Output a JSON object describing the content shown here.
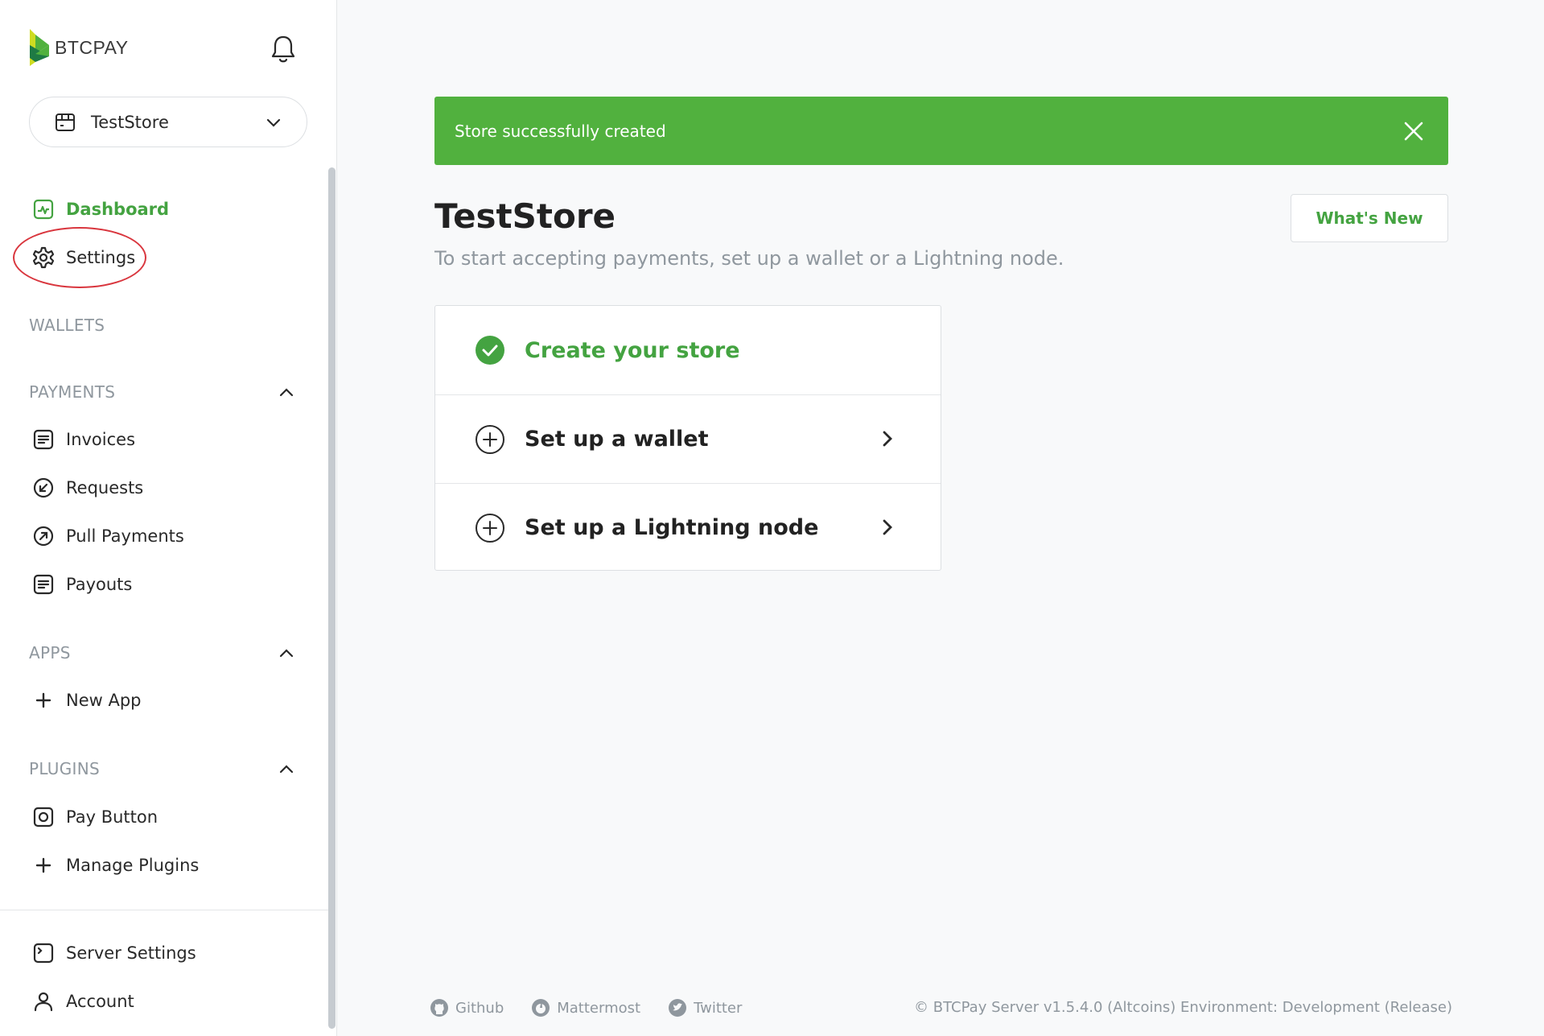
{
  "brand": {
    "name": "BTCPAY",
    "accent": "#44a341"
  },
  "store_selector": {
    "value": "TestStore"
  },
  "nav": {
    "dashboard": "Dashboard",
    "settings": "Settings",
    "wallets_section": "WALLETS",
    "payments_section": "PAYMENTS",
    "invoices": "Invoices",
    "requests": "Requests",
    "pull_payments": "Pull Payments",
    "payouts": "Payouts",
    "apps_section": "APPS",
    "new_app": "New App",
    "plugins_section": "PLUGINS",
    "pay_button": "Pay Button",
    "manage_plugins": "Manage Plugins",
    "server_settings": "Server Settings",
    "account": "Account"
  },
  "alert": {
    "text": "Store successfully created",
    "color": "#51b13e"
  },
  "main": {
    "title": "TestStore",
    "subtitle": "To start accepting payments, set up a wallet or a Lightning node.",
    "whats_new": "What's New"
  },
  "setup_steps": [
    {
      "label": "Create your store",
      "status": "done"
    },
    {
      "label": "Set up a wallet",
      "status": "todo"
    },
    {
      "label": "Set up a Lightning node",
      "status": "todo"
    }
  ],
  "footer": {
    "github": "Github",
    "mattermost": "Mattermost",
    "twitter": "Twitter",
    "copyright": "© BTCPay Server v1.5.4.0 (Altcoins) Environment: Development (Release)"
  }
}
